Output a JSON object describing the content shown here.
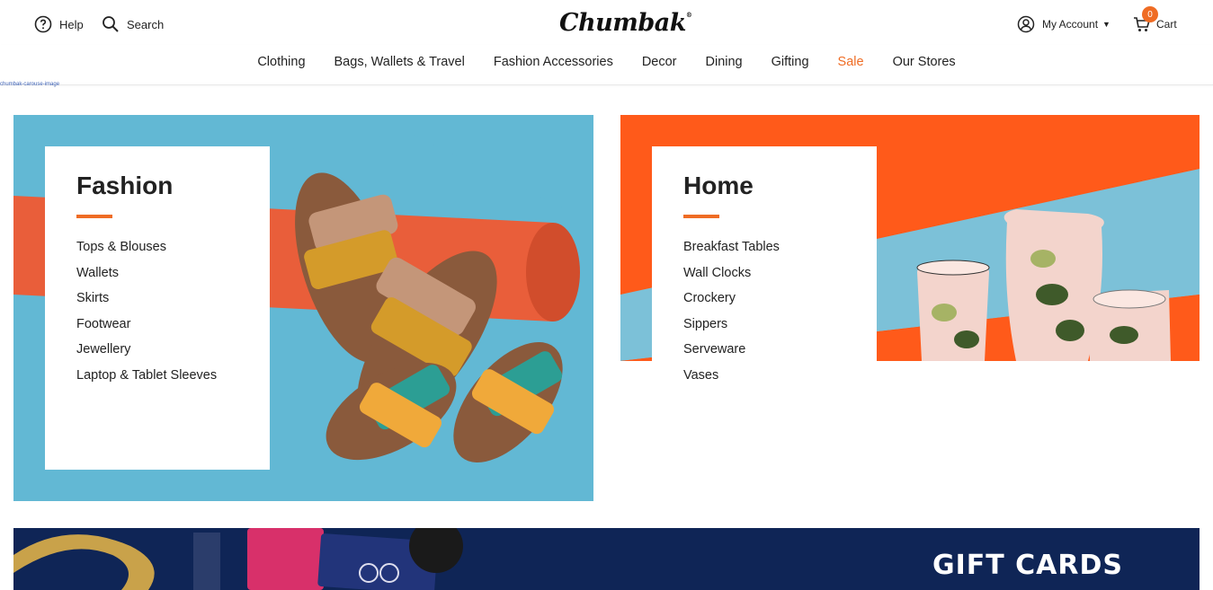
{
  "header": {
    "help_label": "Help",
    "search_label": "Search",
    "logo_text": "Chumbak",
    "logo_reg": "®",
    "account_label": "My Account",
    "cart_label": "Cart",
    "cart_count": "0"
  },
  "nav": {
    "items": [
      {
        "label": "Clothing"
      },
      {
        "label": "Bags, Wallets & Travel"
      },
      {
        "label": "Fashion Accessories"
      },
      {
        "label": "Decor"
      },
      {
        "label": "Dining"
      },
      {
        "label": "Gifting"
      },
      {
        "label": "Sale"
      },
      {
        "label": "Our Stores"
      }
    ]
  },
  "carousel_alt": "chumbak-carouse-image",
  "fashion": {
    "title": "Fashion",
    "items": [
      "Tops & Blouses",
      "Wallets",
      "Skirts",
      "Footwear",
      "Jewellery",
      "Laptop & Tablet Sleeves"
    ]
  },
  "home": {
    "title": "Home",
    "items": [
      "Breakfast Tables",
      "Wall Clocks",
      "Crockery",
      "Sippers",
      "Serveware",
      "Vases"
    ]
  },
  "gift_banner": {
    "title": "GIFT CARDS"
  },
  "colors": {
    "accent": "#ef6c24",
    "fashion_bg": "#62b8d4",
    "home_bg": "#ff5a1a",
    "gift_bg": "#0f2556"
  },
  "icons": {
    "help": "help-circle-icon",
    "search": "search-icon",
    "account": "user-circle-icon",
    "cart": "cart-icon"
  }
}
